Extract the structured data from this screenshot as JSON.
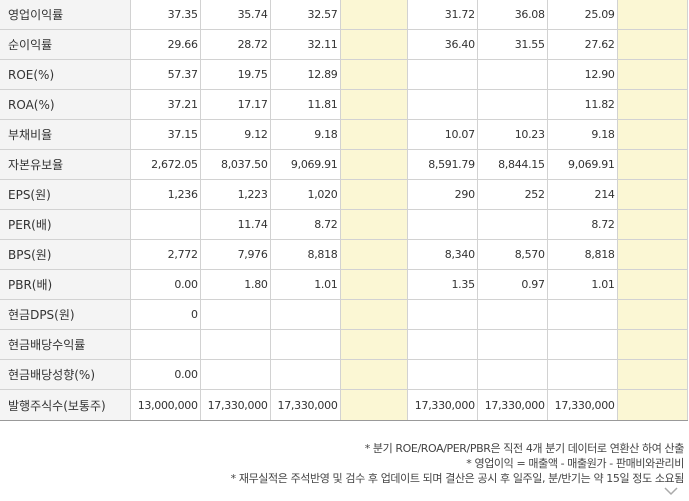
{
  "table": {
    "rows": [
      {
        "label": "영업이익률",
        "cells": [
          "37.35",
          "35.74",
          "32.57",
          "",
          "31.72",
          "36.08",
          "25.09",
          ""
        ]
      },
      {
        "label": "순이익률",
        "cells": [
          "29.66",
          "28.72",
          "32.11",
          "",
          "36.40",
          "31.55",
          "27.62",
          ""
        ]
      },
      {
        "label": "ROE(%)",
        "cells": [
          "57.37",
          "19.75",
          "12.89",
          "",
          "",
          "",
          "12.90",
          ""
        ]
      },
      {
        "label": "ROA(%)",
        "cells": [
          "37.21",
          "17.17",
          "11.81",
          "",
          "",
          "",
          "11.82",
          ""
        ]
      },
      {
        "label": "부채비율",
        "cells": [
          "37.15",
          "9.12",
          "9.18",
          "",
          "10.07",
          "10.23",
          "9.18",
          ""
        ]
      },
      {
        "label": "자본유보율",
        "cells": [
          "2,672.05",
          "8,037.50",
          "9,069.91",
          "",
          "8,591.79",
          "8,844.15",
          "9,069.91",
          ""
        ]
      },
      {
        "label": "EPS(원)",
        "cells": [
          "1,236",
          "1,223",
          "1,020",
          "",
          "290",
          "252",
          "214",
          ""
        ]
      },
      {
        "label": "PER(배)",
        "cells": [
          "",
          "11.74",
          "8.72",
          "",
          "",
          "",
          "8.72",
          ""
        ]
      },
      {
        "label": "BPS(원)",
        "cells": [
          "2,772",
          "7,976",
          "8,818",
          "",
          "8,340",
          "8,570",
          "8,818",
          ""
        ]
      },
      {
        "label": "PBR(배)",
        "cells": [
          "0.00",
          "1.80",
          "1.01",
          "",
          "1.35",
          "0.97",
          "1.01",
          ""
        ]
      },
      {
        "label": "현금DPS(원)",
        "cells": [
          "0",
          "",
          "",
          "",
          "",
          "",
          "",
          ""
        ]
      },
      {
        "label": "현금배당수익률",
        "cells": [
          "",
          "",
          "",
          "",
          "",
          "",
          "",
          ""
        ]
      },
      {
        "label": "현금배당성향(%)",
        "cells": [
          "0.00",
          "",
          "",
          "",
          "",
          "",
          "",
          ""
        ]
      },
      {
        "label": "발행주식수(보통주)",
        "cells": [
          "13,000,000",
          "17,330,000",
          "17,330,000",
          "",
          "17,330,000",
          "17,330,000",
          "17,330,000",
          ""
        ]
      }
    ]
  },
  "notes": {
    "line1": "* 분기 ROE/ROA/PER/PBR은 직전 4개 분기 데이터로 연환산 하여 산출",
    "line2": "* 영업이익 = 매출액 - 매출원가 - 판매비와관리비",
    "line3": "* 재무실적은 주석반영 및 검수 후 업데이트 되며 결산은 공시 후 일주일, 분/반기는 약 15일 정도 소요됨"
  }
}
